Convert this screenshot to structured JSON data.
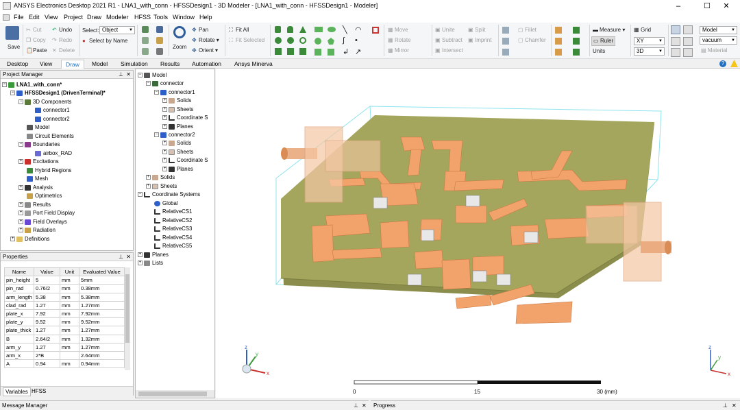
{
  "window": {
    "title": "ANSYS Electronics Desktop 2021 R1 - LNA1_with_conn - HFSSDesign1 - 3D Modeler - [LNA1_with_conn - HFSSDesign1 - Modeler]",
    "min": "–",
    "max": "☐",
    "close": "✕"
  },
  "menu": [
    "File",
    "Edit",
    "View",
    "Project",
    "Draw",
    "Modeler",
    "HFSS",
    "Tools",
    "Window",
    "Help"
  ],
  "ribbon": {
    "save": "Save",
    "cut": "Cut",
    "copy": "Copy",
    "paste": "Paste",
    "undo": "Undo",
    "redo": "Redo",
    "delete": "Delete",
    "select_label": "Select:",
    "select_value": "Object",
    "select_by_name": "Select by Name",
    "zoom": "Zoom",
    "pan": "Pan",
    "rotate": "Rotate",
    "orient": "Orient",
    "fit_all": "Fit All",
    "fit_selected": "Fit Selected",
    "move": "Move",
    "rotate2": "Rotate",
    "mirror": "Mirror",
    "unite": "Unite",
    "subtract": "Subtract",
    "intersect": "Intersect",
    "split": "Split",
    "imprint": "Imprint",
    "fillet": "Fillet",
    "chamfer": "Chamfer",
    "measure": "Measure",
    "ruler": "Ruler",
    "units": "Units",
    "grid": "Grid",
    "grid_plane": "XY",
    "grid_dim": "3D",
    "model_combo": "Model",
    "material_combo": "vacuum",
    "material": "Material"
  },
  "tabs": [
    "Desktop",
    "View",
    "Draw",
    "Model",
    "Simulation",
    "Results",
    "Automation",
    "Ansys Minerva"
  ],
  "active_tab": "Draw",
  "project_manager": {
    "title": "Project Manager",
    "items": [
      {
        "label": "LNA1_with_conn*",
        "bold": true
      },
      {
        "label": "HFSSDesign1 (DrivenTerminal)*",
        "bold": true
      },
      {
        "label": "3D Components"
      },
      {
        "label": "connector1"
      },
      {
        "label": "connector2"
      },
      {
        "label": "Model"
      },
      {
        "label": "Circuit Elements"
      },
      {
        "label": "Boundaries"
      },
      {
        "label": "airbox_RAD"
      },
      {
        "label": "Excitations"
      },
      {
        "label": "Hybrid Regions"
      },
      {
        "label": "Mesh"
      },
      {
        "label": "Analysis"
      },
      {
        "label": "Optimetrics"
      },
      {
        "label": "Results"
      },
      {
        "label": "Port Field Display"
      },
      {
        "label": "Field Overlays"
      },
      {
        "label": "Radiation"
      },
      {
        "label": "Definitions"
      }
    ]
  },
  "properties": {
    "title": "Properties",
    "headers": [
      "Name",
      "Value",
      "Unit",
      "Evaluated Value"
    ],
    "rows": [
      [
        "pin_height",
        "5",
        "mm",
        "5mm"
      ],
      [
        "pin_rad",
        "0.76/2",
        "mm",
        "0.38mm"
      ],
      [
        "arm_length",
        "5.38",
        "mm",
        "5.38mm"
      ],
      [
        "clad_rad",
        "1.27",
        "mm",
        "1.27mm"
      ],
      [
        "plate_x",
        "7.92",
        "mm",
        "7.92mm"
      ],
      [
        "plate_y",
        "9.52",
        "mm",
        "9.52mm"
      ],
      [
        "plate_thick",
        "1.27",
        "mm",
        "1.27mm"
      ],
      [
        "B",
        "2.64/2",
        "mm",
        "1.32mm"
      ],
      [
        "arm_y",
        "1.27",
        "mm",
        "1.27mm"
      ],
      [
        "arm_x",
        "2*B",
        "",
        "2.64mm"
      ],
      [
        "A",
        "0.94",
        "mm",
        "0.94mm"
      ]
    ],
    "tab_variables": "Variables",
    "tab_hfss": "HFSS"
  },
  "model_tree": {
    "items": [
      {
        "label": "Model"
      },
      {
        "label": "connector"
      },
      {
        "label": "connector1"
      },
      {
        "label": "Solids"
      },
      {
        "label": "Sheets"
      },
      {
        "label": "Coordinate S"
      },
      {
        "label": "Planes"
      },
      {
        "label": "connector2"
      },
      {
        "label": "Solids"
      },
      {
        "label": "Sheets"
      },
      {
        "label": "Coordinate S"
      },
      {
        "label": "Planes"
      },
      {
        "label": "Solids"
      },
      {
        "label": "Sheets"
      },
      {
        "label": "Coordinate Systems"
      },
      {
        "label": "Global"
      },
      {
        "label": "RelativeCS1"
      },
      {
        "label": "RelativeCS2"
      },
      {
        "label": "RelativeCS3"
      },
      {
        "label": "RelativeCS4"
      },
      {
        "label": "RelativeCS5"
      },
      {
        "label": "Planes"
      },
      {
        "label": "Lists"
      }
    ]
  },
  "viewport": {
    "scale_labels": [
      "0",
      "15",
      "30 (mm)"
    ],
    "axis_x": "x",
    "axis_y": "y",
    "axis_z": "z"
  },
  "bottom": {
    "message_manager": "Message Manager",
    "progress": "Progress"
  },
  "colors": {
    "board": "#a3a65c",
    "trace": "#f2a36b",
    "connector": "#f5c8a5",
    "airbox": "#8fe3ee"
  }
}
